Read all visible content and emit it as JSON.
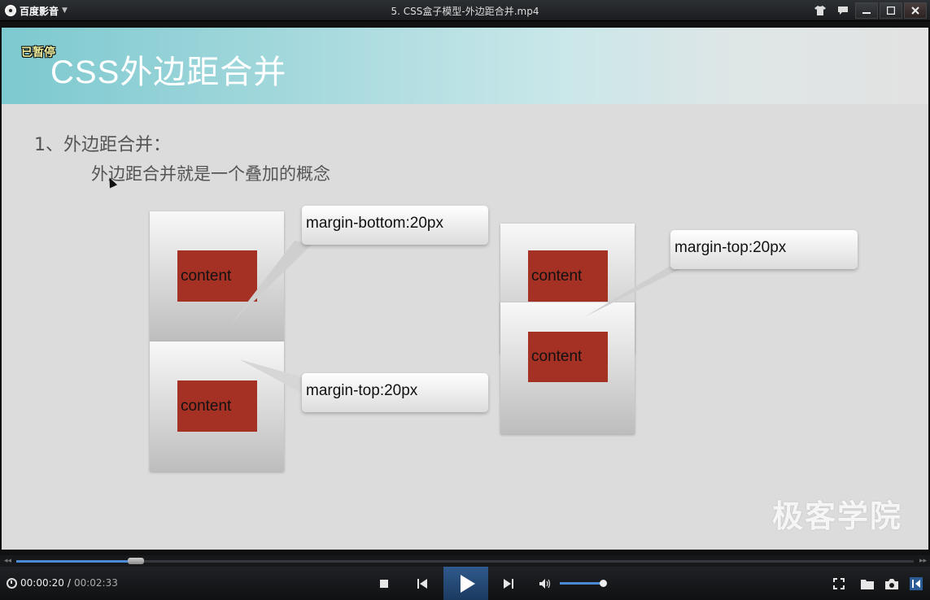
{
  "window": {
    "app_name": "百度影音",
    "file_title": "5. CSS盒子模型-外边距合并.mp4"
  },
  "video": {
    "paused_label": "已暂停",
    "slide_title": "CSS外边距合并",
    "heading": "1、外边距合并：",
    "subheading": "外边距合并就是一个叠加的概念",
    "diagram": {
      "content_label": "content",
      "callout_margin_bottom": "margin-bottom:20px",
      "callout_margin_top_left": "margin-top:20px",
      "callout_margin_top_right": "margin-top:20px"
    },
    "watermark": "极客学院",
    "colors": {
      "content_fill": "#a53125",
      "header_teal": "#7cc9cf"
    }
  },
  "player": {
    "current_time": "00:00:20",
    "separator": "/",
    "total_time": "00:02:33",
    "progress_fraction": 0.13,
    "volume_fraction": 0.95,
    "icons": [
      "clock-icon",
      "stop-icon",
      "previous-icon",
      "play-icon",
      "next-icon",
      "volume-icon",
      "fullscreen-icon",
      "folder-icon",
      "camera-icon",
      "playlist-toggle-icon"
    ]
  }
}
